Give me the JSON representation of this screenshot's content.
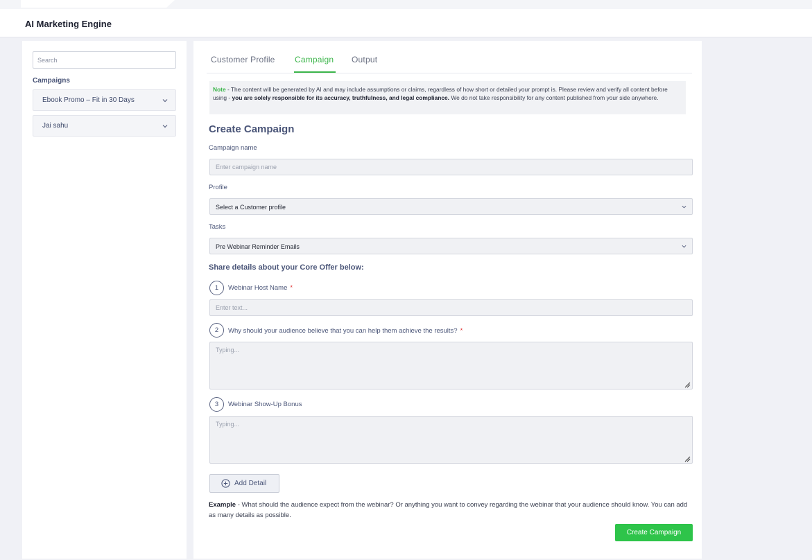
{
  "app": {
    "title": "AI Marketing Engine"
  },
  "sidebar": {
    "search_placeholder": "Search",
    "heading": "Campaigns",
    "items": [
      {
        "label": "Ebook Promo – Fit in 30 Days"
      },
      {
        "label": "Jai sahu"
      }
    ]
  },
  "tabs": [
    {
      "label": "Customer Profile",
      "active": false
    },
    {
      "label": "Campaign",
      "active": true
    },
    {
      "label": "Output",
      "active": false
    }
  ],
  "note": {
    "label": "Note",
    "text1": " - The content will be generated by AI and may include assumptions or claims, regardless of how short or detailed your prompt is. Please review and verify all content before using - ",
    "bold": "you are solely responsible for its accuracy, truthfulness, and legal compliance.",
    "text2": " We do not take responsibility for any content published from your side anywhere."
  },
  "form": {
    "title": "Create Campaign",
    "campaign_name_label": "Campaign name",
    "campaign_name_placeholder": "Enter campaign name",
    "profile_label": "Profile",
    "profile_value": "Select a Customer profile",
    "tasks_label": "Tasks",
    "tasks_value": "Pre Webinar Reminder Emails",
    "core_offer_title": "Share details about your Core Offer below:",
    "details": [
      {
        "num": "1",
        "label": "Webinar Host Name",
        "required": "*",
        "placeholder": "Enter text..."
      },
      {
        "num": "2",
        "label": "Why should your audience believe that you can help them achieve the results?",
        "required": "*",
        "placeholder": "Typing..."
      },
      {
        "num": "3",
        "label": "Webinar Show-Up Bonus",
        "required": "",
        "placeholder": "Typing..."
      }
    ],
    "add_detail_label": "Add Detail",
    "example_label": "Example",
    "example_text": " - What should the audience expect from the webinar? Or anything you want to convey regarding the webinar that your audience should know. You can add as many details as possible.",
    "submit_label": "Create Campaign"
  },
  "colors": {
    "accent": "#3bb54a",
    "button": "#2ec44a",
    "heading": "#4a5578",
    "required": "#e03131"
  },
  "icons": [
    "chevron-down-icon",
    "plus-circle-icon",
    "resize-grip-icon"
  ]
}
